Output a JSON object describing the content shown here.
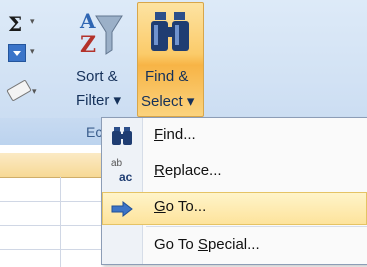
{
  "ribbon": {
    "sort_filter": {
      "line1": "Sort &",
      "line2": "Filter ▾"
    },
    "find_select": {
      "line1": "Find &",
      "line2": "Select ▾"
    },
    "group_label": "Ec",
    "icons": [
      "autosum-icon",
      "fill-icon",
      "clear-icon",
      "sort-filter-icon",
      "binoculars-icon"
    ]
  },
  "menu": {
    "items": [
      {
        "pre": "",
        "ul": "F",
        "post": "ind...",
        "icon": "binoculars-icon",
        "highlighted": false
      },
      {
        "pre": "",
        "ul": "R",
        "post": "eplace...",
        "icon": "replace-icon",
        "highlighted": false
      },
      {
        "pre": "",
        "ul": "G",
        "post": "o To...",
        "icon": "arrow-right-icon",
        "highlighted": true
      },
      {
        "pre": "Go To ",
        "ul": "S",
        "post": "pecial...",
        "icon": "",
        "highlighted": false
      }
    ],
    "replace_icon_text": {
      "top": "ab",
      "bottom": "ac"
    }
  },
  "colors": {
    "highlight": "#fde39c",
    "ribbon": "#d2e2f4",
    "find_select_bg": "#fbcb6a"
  }
}
